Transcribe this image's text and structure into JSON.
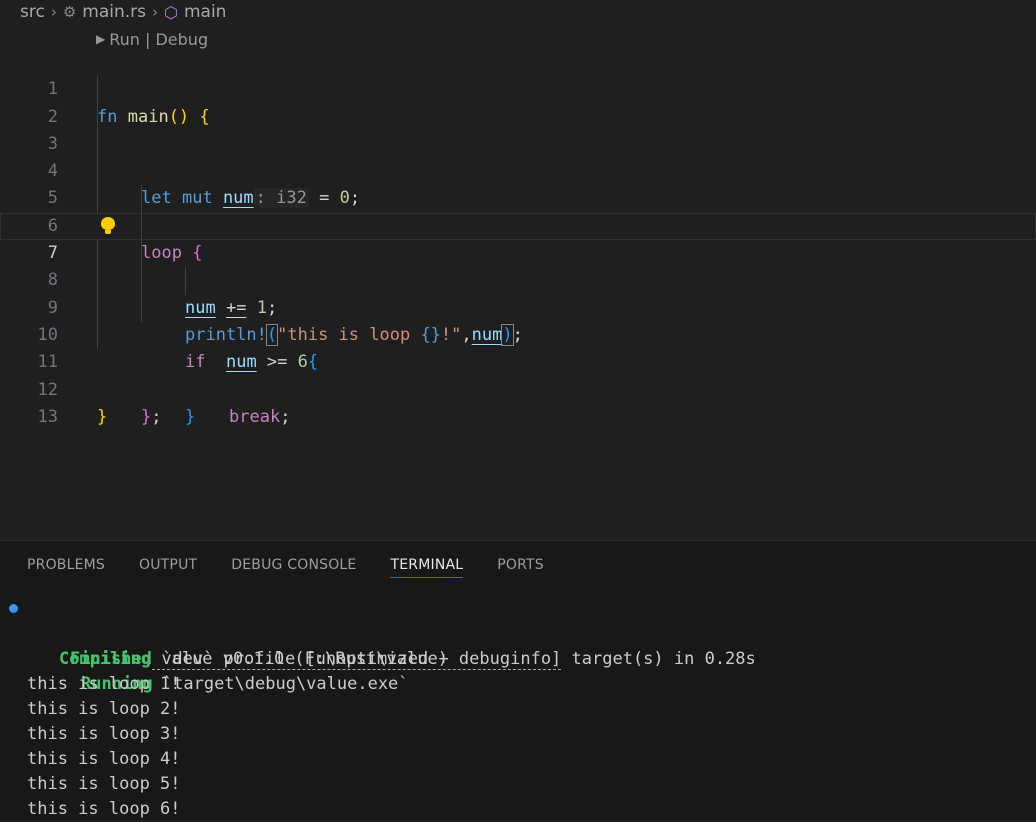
{
  "breadcrumb": {
    "folder": "src",
    "file": "main.rs",
    "symbol": "main"
  },
  "codelens": {
    "label": "Run | Debug"
  },
  "editor": {
    "line_numbers": [
      "1",
      "2",
      "3",
      "4",
      "5",
      "6",
      "7",
      "8",
      "9",
      "10",
      "11",
      "12",
      "13"
    ],
    "active_line": 7,
    "code": {
      "l1_fn": "fn",
      "l1_name": "main",
      "l1_paren": "()",
      "l1_brace": "{",
      "l3_let": "let",
      "l3_mut": "mut",
      "l3_var": "num",
      "l3_hint": ": i32",
      "l3_eq": " = ",
      "l3_val": "0",
      "l3_end": ";",
      "l5_loop": "loop",
      "l5_brace": "{",
      "l6_var": "num",
      "l6_op": "+=",
      "l6_val": "1",
      "l6_end": ";",
      "l7_macro": "println!",
      "l7_open": "(",
      "l7_str1": "\"this is loop ",
      "l7_ph": "{}",
      "l7_str2": "!\"",
      "l7_comma": ",",
      "l7_var": "num",
      "l7_close": ")",
      "l7_end": ";",
      "l8_if": "if",
      "l8_var": "num",
      "l8_op": " >= ",
      "l8_val": "6",
      "l8_brace": "{",
      "l9_break": "break",
      "l9_end": ";",
      "l10_brace": "}",
      "l11_brace": "}",
      "l11_end": ";",
      "l12_brace": "}"
    }
  },
  "panel": {
    "tabs": [
      "PROBLEMS",
      "OUTPUT",
      "DEBUG CONSOLE",
      "TERMINAL",
      "PORTS"
    ],
    "active_tab": "TERMINAL"
  },
  "terminal": {
    "compiling_label": "Compiling",
    "compiling_text": " value v0.1.0 (F:\\Rust\\value)",
    "finished_label": "Finished",
    "finished_pre": " `dev` profile [unoptimized + debuginfo]",
    "finished_post": " target(s) in 0.28s",
    "running_label": "Running",
    "running_text": " `target\\debug\\value.exe`",
    "output": [
      "this is loop 1!",
      "this is loop 2!",
      "this is loop 3!",
      "this is loop 4!",
      "this is loop 5!",
      "this is loop 6!"
    ]
  },
  "colors": {
    "background": "#1f1f1f",
    "panel_background": "#181818",
    "accent": "#0078d4",
    "terminal_green": "#3fc66a"
  }
}
